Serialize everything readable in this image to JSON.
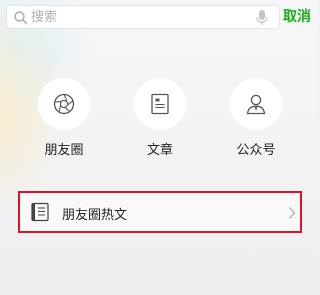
{
  "search": {
    "placeholder": "搜索",
    "cancel_label": "取消"
  },
  "shortcuts": [
    {
      "label": "朋友圈",
      "icon": "aperture-icon"
    },
    {
      "label": "文章",
      "icon": "document-icon"
    },
    {
      "label": "公众号",
      "icon": "person-icon"
    }
  ],
  "hot_row": {
    "label": "朋友圈热文",
    "icon": "article-icon"
  },
  "colors": {
    "accent": "#1aad19",
    "highlight_border": "#e0141e",
    "background": "#f1f1f4"
  }
}
